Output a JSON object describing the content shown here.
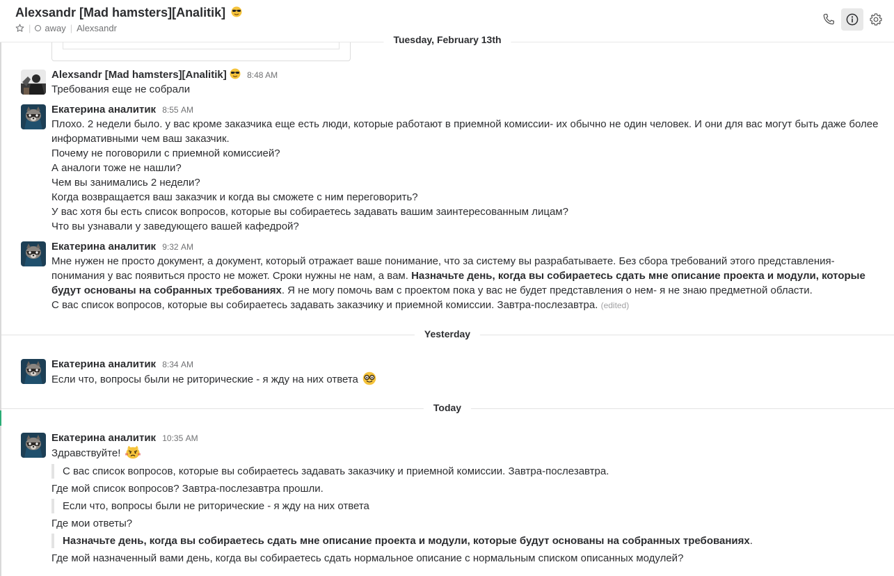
{
  "header": {
    "title": "Alexsandr [Mad hamsters][Analitik]",
    "title_emoji": "smiling-face-with-sunglasses",
    "status": "away",
    "full_name": "Alexsandr",
    "icons": [
      "phone-icon",
      "info-icon",
      "gear-icon"
    ]
  },
  "dividers": {
    "d1": "Tuesday, February 13th",
    "d2": "Yesterday",
    "d3": "Today"
  },
  "messages": {
    "m1": {
      "author": "Alexsandr [Mad hamsters][Analitik]",
      "time": "8:48 AM",
      "lines": [
        "Требования еще не собрали"
      ]
    },
    "m2": {
      "author": "Екатерина аналитик",
      "time": "8:55 AM",
      "lines": [
        "Плохо. 2 недели было. у вас кроме заказчика еще есть люди, которые работают в приемной комиссии- их обычно не один человек. И они для вас могут быть даже более информативными чем ваш заказчик.",
        "Почему не поговорили с приемной комиссией?",
        "А аналоги тоже не нашли?",
        "Чем вы занимались 2 недели?",
        "Когда возвращается ваш заказчик и когда вы сможете с ним переговорить?",
        "У вас хотя бы есть список вопросов, которые вы собираетесь задавать вашим заинтересованным лицам?",
        "Что вы узнавали у заведующего вашей кафедрой?"
      ]
    },
    "m3": {
      "author": "Екатерина аналитик",
      "time": "9:32 AM",
      "p1_a": "Мне нужен не просто документ, а документ, который отражает ваше понимание, что за систему вы разрабатываете. Без сбора требований этого представления- понимания у вас появиться просто не может.  Сроки нужны не нам, а вам. ",
      "p1_bold": "Назначьте день, когда вы собираетесь сдать мне описание проекта и модули, которые будут основаны на собранных требованиях",
      "p1_c": ". Я не могу помочь вам с проектом пока у вас не будет представления о нем- я не знаю предметной области.",
      "p2": "С вас список вопросов, которые вы собираетесь задавать заказчику и приемной комиссии. Завтра-послезавтра.",
      "edited": "(edited)"
    },
    "m4": {
      "author": "Екатерина аналитик",
      "time": "8:34 AM",
      "text": "Если что, вопросы были не риторические - я жду на них ответа",
      "emoji": "nerd-face"
    },
    "m5": {
      "author": "Екатерина аналитик",
      "time": "10:35 AM",
      "greeting": "Здравствуйте!",
      "emoji": "pouting-cat",
      "q1": "С вас список вопросов, которые вы собираетесь задавать заказчику и приемной комиссии. Завтра-послезавтра.",
      "l1": "Где мой список вопросов? Завтра-послезавтра прошли.",
      "q2": "Если что, вопросы были не риторические - я жду на них ответа",
      "l2": "Где мои ответы?",
      "q3_bold": "Назначьте день, когда вы собираетесь сдать мне описание проекта и модули, которые будут основаны на собранных требованиях",
      "q3_end": ".",
      "l3": "Где мой назначенный вами день, когда вы собираетесь сдать нормальное описание с нормальным списком описанных модулей?"
    }
  }
}
